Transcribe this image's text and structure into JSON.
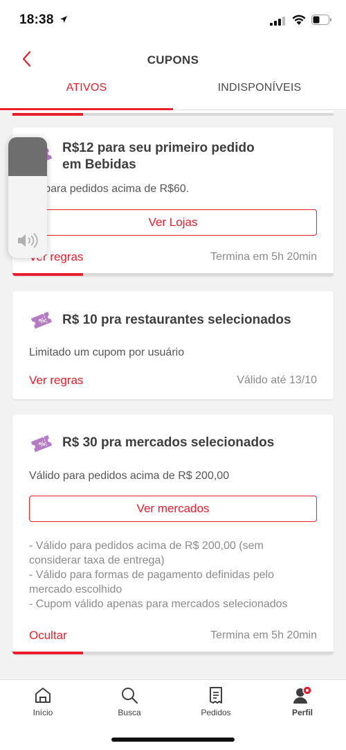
{
  "status_bar": {
    "time": "18:38"
  },
  "header": {
    "title": "CUPONS",
    "tabs": {
      "active": "ATIVOS",
      "inactive": "INDISPONÍVEIS"
    }
  },
  "coupons": [
    {
      "title_line1": "R$12 para seu primeiro pedido",
      "title_line2": "em Bebidas",
      "description": "do para pedidos acima de R$60.",
      "button": "Ver Lojas",
      "rules_link": "Ver regras",
      "expiry": "Termina em 5h 20min",
      "progress": 0.22
    },
    {
      "title_line1": "R$ 10 pra restaurantes selecionados",
      "description": "Limitado um cupom por usuário",
      "rules_link": "Ver regras",
      "expiry": "Válido até 13/10"
    },
    {
      "title_line1": "R$ 30 pra mercados selecionados",
      "description": "Válido para pedidos acima de R$ 200,00",
      "button": "Ver mercados",
      "rules": [
        "- Válido para pedidos acima de R$ 200,00 (sem",
        "considerar taxa de entrega)",
        "- Válido para formas de pagamento definidas pelo",
        "mercado escolhido",
        "- Cupom válido apenas para mercados selecionados"
      ],
      "rules_link": "Ocultar",
      "expiry": "Termina em 5h 20min",
      "progress": 0.22
    }
  ],
  "nav": {
    "items": [
      {
        "label": "Início",
        "icon": "home-icon"
      },
      {
        "label": "Busca",
        "icon": "search-icon"
      },
      {
        "label": "Pedidos",
        "icon": "orders-icon"
      },
      {
        "label": "Perfil",
        "icon": "profile-icon"
      }
    ]
  },
  "colors": {
    "accent": "#ea1d2c",
    "ticket": "#b57bc4",
    "text": "#3e3e3e",
    "muted": "#8a8a8a"
  }
}
